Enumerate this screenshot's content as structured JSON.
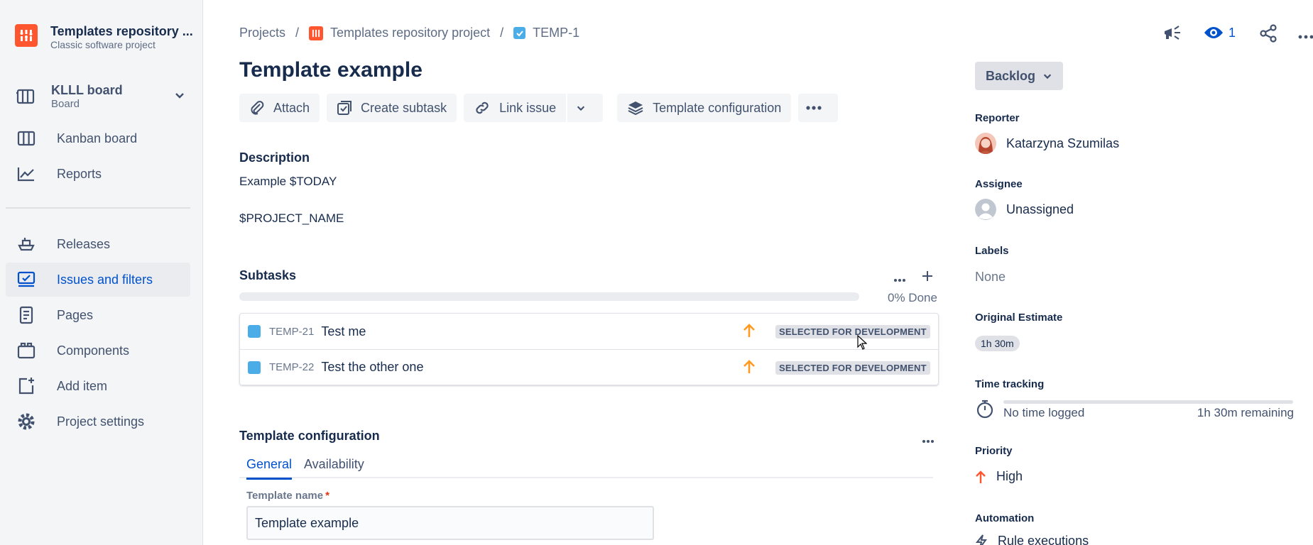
{
  "sidebar": {
    "project_name": "Templates repository ...",
    "project_type": "Classic software project",
    "board_name": "KLLL board",
    "board_type": "Board",
    "items": [
      {
        "label": "Kanban board"
      },
      {
        "label": "Reports"
      },
      {
        "label": "Releases"
      },
      {
        "label": "Issues and filters"
      },
      {
        "label": "Pages"
      },
      {
        "label": "Components"
      },
      {
        "label": "Add item"
      },
      {
        "label": "Project settings"
      }
    ]
  },
  "breadcrumb": {
    "projects": "Projects",
    "project": "Templates repository project",
    "issue": "TEMP-1",
    "sep": "/"
  },
  "issue": {
    "title": "Template example",
    "toolbar": {
      "attach": "Attach",
      "create_subtask": "Create subtask",
      "link_issue": "Link issue",
      "template_config": "Template configuration"
    },
    "description_heading": "Description",
    "description_line1": "Example $TODAY",
    "description_line2": "$PROJECT_NAME",
    "subtasks_heading": "Subtasks",
    "subtasks_progress": 0,
    "subtasks_progress_label": "0% Done",
    "subtasks": [
      {
        "key": "TEMP-21",
        "summary": "Test me",
        "status": "SELECTED FOR DEVELOPMENT"
      },
      {
        "key": "TEMP-22",
        "summary": "Test the other one",
        "status": "SELECTED FOR DEVELOPMENT"
      }
    ],
    "template_config_heading": "Template configuration",
    "tabs": [
      {
        "label": "General"
      },
      {
        "label": "Availability"
      }
    ],
    "template_name_label": "Template name",
    "template_name_required": "*",
    "template_name_value": "Template example"
  },
  "topbar": {
    "watchers_count": "1"
  },
  "details": {
    "status": "Backlog",
    "reporter_label": "Reporter",
    "reporter": "Katarzyna Szumilas",
    "assignee_label": "Assignee",
    "assignee": "Unassigned",
    "labels_label": "Labels",
    "labels": "None",
    "original_estimate_label": "Original Estimate",
    "original_estimate": "1h 30m",
    "time_tracking_label": "Time tracking",
    "time_logged": "No time logged",
    "time_remaining": "1h 30m remaining",
    "priority_label": "Priority",
    "priority": "High",
    "automation_label": "Automation",
    "automation": "Rule executions"
  },
  "colors": {
    "accent": "#0052cc",
    "project_logo": "#ff5630",
    "subtask_icon": "#4bade8",
    "priority_high": "#ff991f"
  },
  "icons": {
    "sidebar": [
      "board-icon",
      "kanban-icon",
      "reports-icon",
      "releases-icon",
      "issues-icon",
      "pages-icon",
      "components-icon",
      "add-item-icon",
      "settings-icon"
    ],
    "topbar": [
      "feedback-icon",
      "watch-icon",
      "share-icon",
      "more-icon"
    ]
  }
}
